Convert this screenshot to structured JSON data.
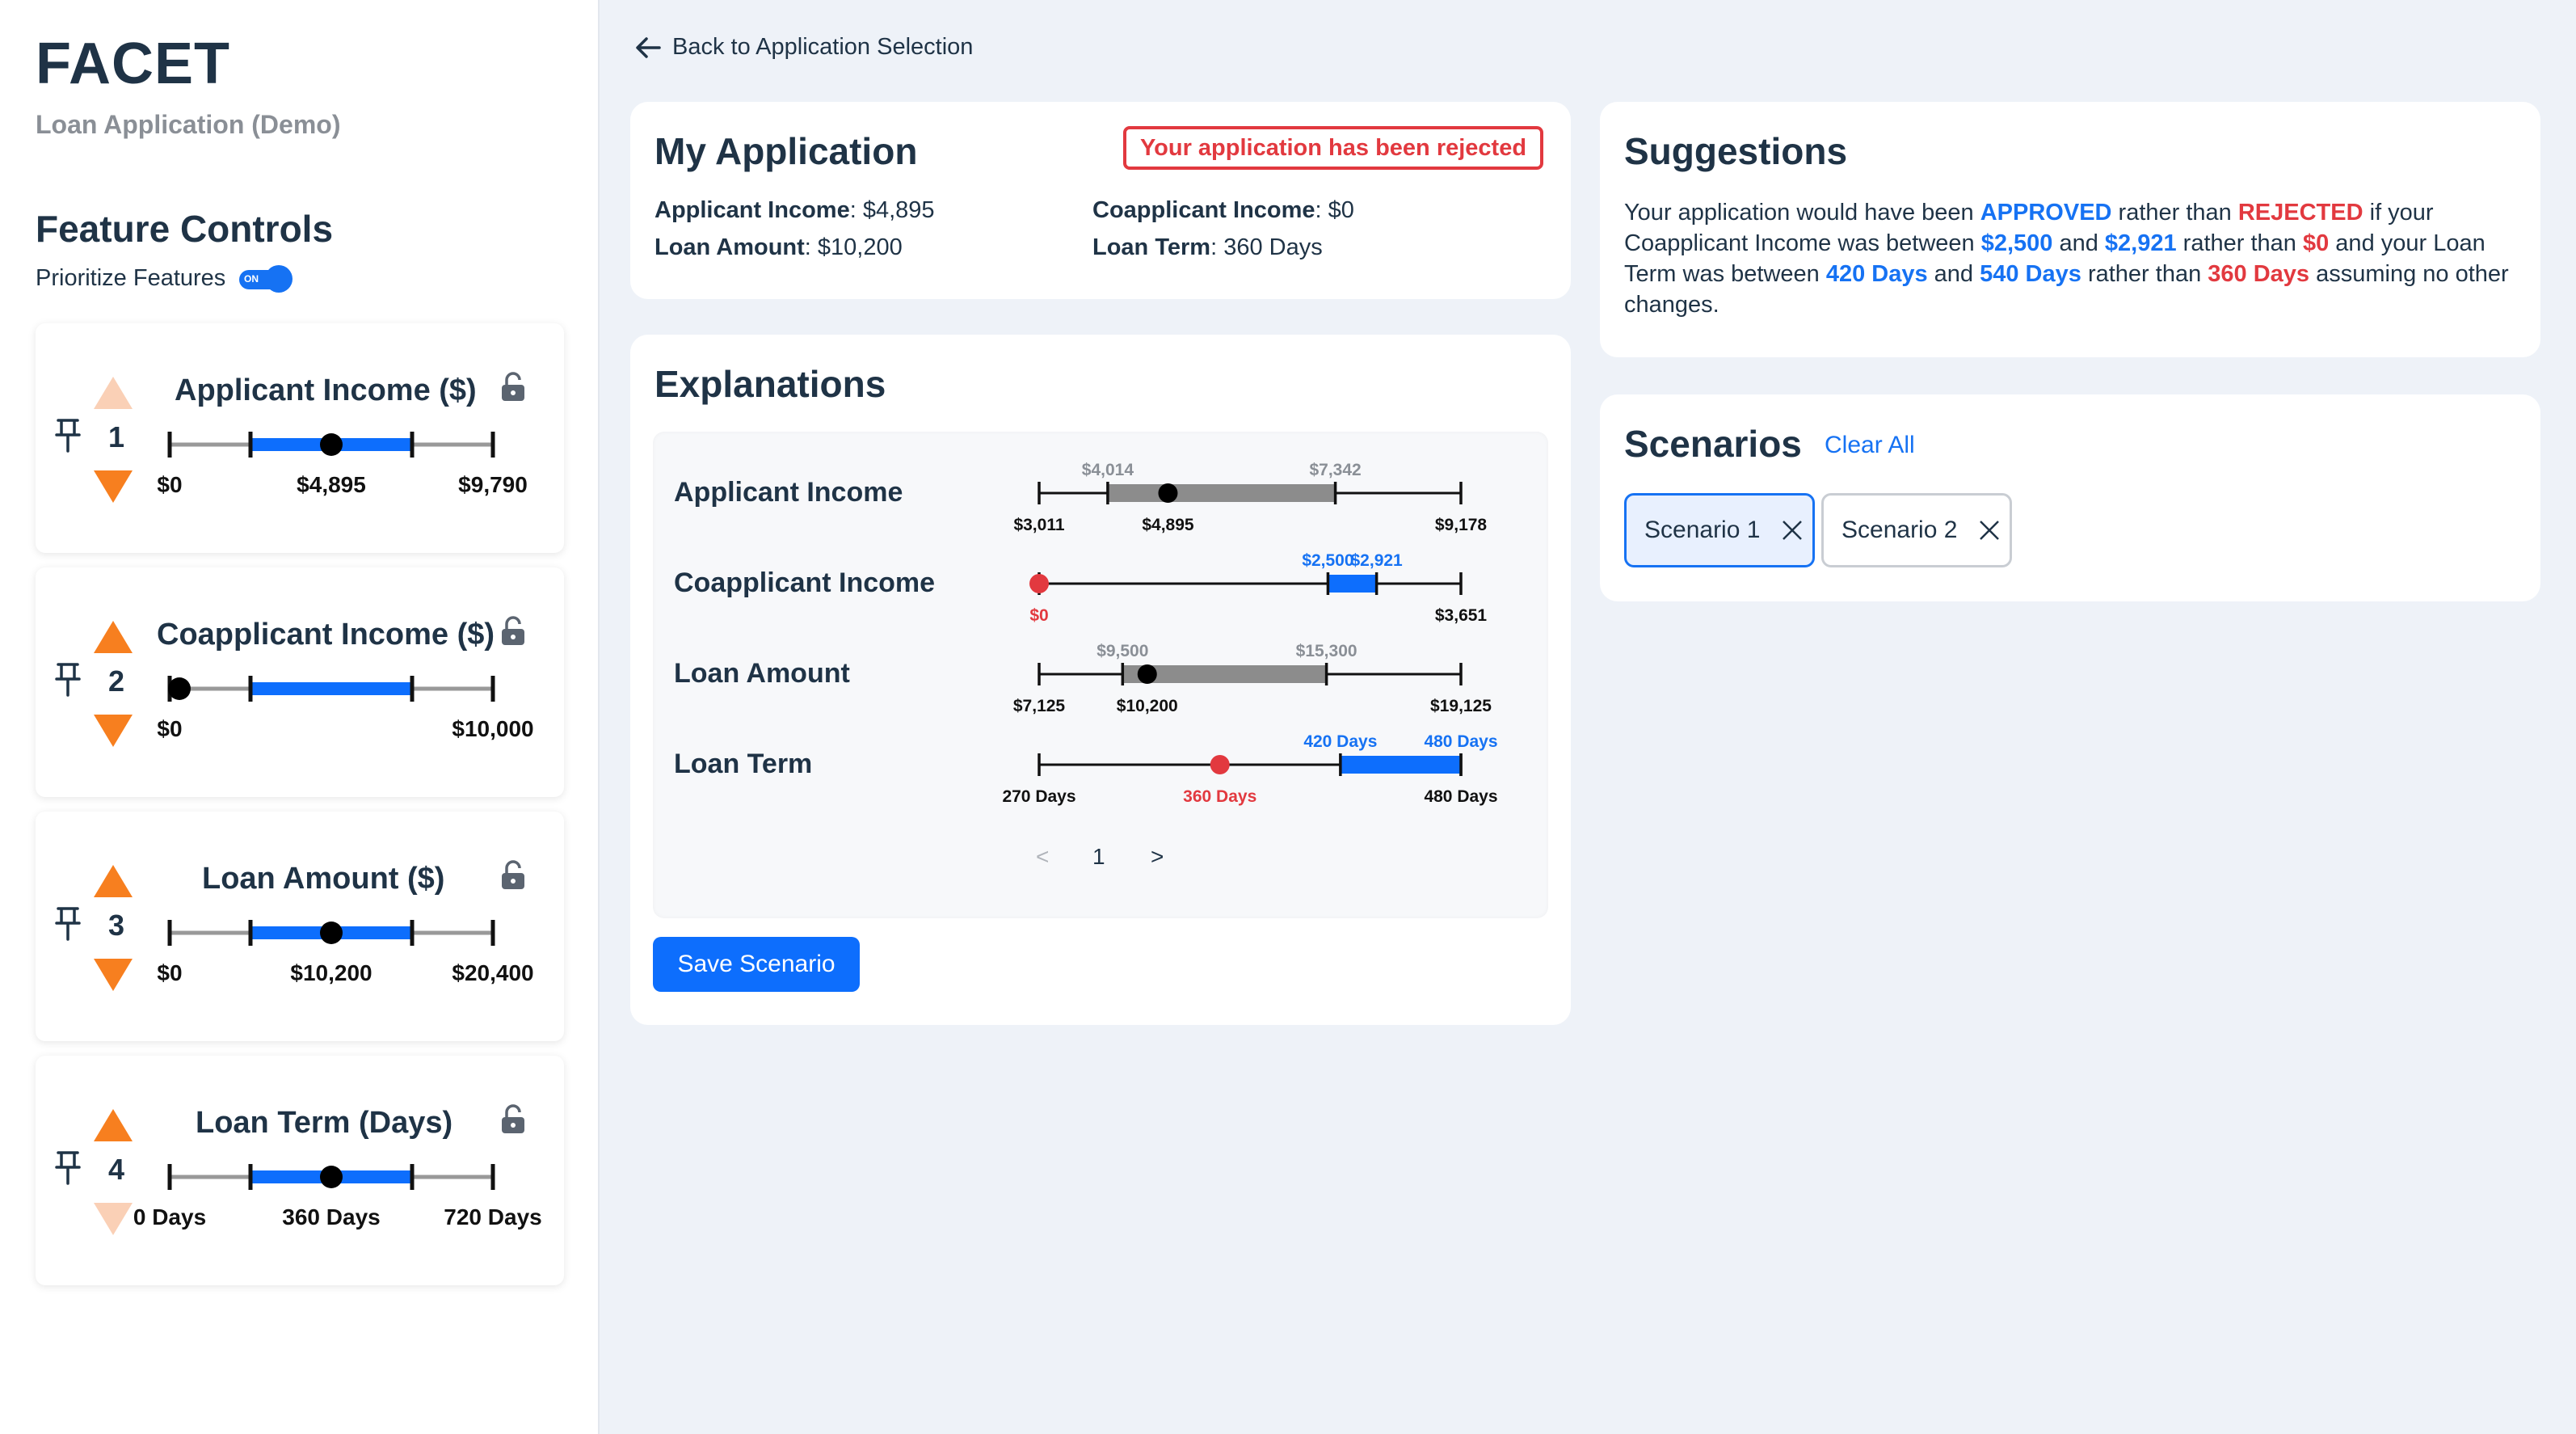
{
  "sidebar": {
    "brand": "FACET",
    "subtitle": "Loan Application (Demo)",
    "feature_controls_title": "Feature Controls",
    "prioritize_label": "Prioritize Features",
    "prioritize_toggle_text": "ON",
    "features": [
      {
        "title": "Applicant Income ($)",
        "rank": "1",
        "min_label": "$0",
        "value_label": "$4,895",
        "max_label": "$9,790",
        "value_fraction": 0.5,
        "range": [
          0.25,
          0.75
        ],
        "up_enabled": false,
        "down_enabled": true
      },
      {
        "title": "Coapplicant Income ($)",
        "rank": "2",
        "min_label": "$0",
        "value_label": "",
        "max_label": "$10,000",
        "value_fraction": 0.03,
        "range": [
          0.25,
          0.75
        ],
        "up_enabled": true,
        "down_enabled": true
      },
      {
        "title": "Loan Amount ($)",
        "rank": "3",
        "min_label": "$0",
        "value_label": "$10,200",
        "max_label": "$20,400",
        "value_fraction": 0.5,
        "range": [
          0.25,
          0.75
        ],
        "up_enabled": true,
        "down_enabled": true
      },
      {
        "title": "Loan Term (Days)",
        "rank": "4",
        "min_label": "0 Days",
        "value_label": "360 Days",
        "max_label": "720 Days",
        "value_fraction": 0.5,
        "range": [
          0.25,
          0.75
        ],
        "up_enabled": true,
        "down_enabled": false
      }
    ]
  },
  "nav": {
    "back_label": "Back to Application Selection"
  },
  "application": {
    "title": "My Application",
    "status": "Your application has been rejected",
    "fields": {
      "applicant_income_label": "Applicant Income",
      "applicant_income_value": ": $4,895",
      "coapplicant_income_label": "Coapplicant Income",
      "coapplicant_income_value": ": $0",
      "loan_amount_label": "Loan Amount",
      "loan_amount_value": ": $10,200",
      "loan_term_label": "Loan Term",
      "loan_term_value": ": 360 Days"
    }
  },
  "explanations": {
    "title": "Explanations",
    "rows": [
      {
        "label": "Applicant Income",
        "min": 3011,
        "max": 9178,
        "min_label": "$3,011",
        "max_label": "$9,178",
        "value": 4895,
        "value_label": "$4,895",
        "range": [
          4014,
          7342
        ],
        "range_labels": [
          "$4,014",
          "$7,342"
        ],
        "range_color": "#8c8c8c",
        "value_color": "#000000",
        "range_label_color": "#8a8f96",
        "value_label_color": "#111111"
      },
      {
        "label": "Coapplicant Income",
        "min": 0,
        "max": 3651,
        "min_label": "",
        "max_label": "$3,651",
        "value": 0,
        "value_label": "$0",
        "range": [
          2500,
          2921
        ],
        "range_labels": [
          "$2,500",
          "$2,921"
        ],
        "range_color": "#0d6efd",
        "value_color": "#e2393f",
        "range_label_color": "#1672f3",
        "value_label_color": "#e2393f"
      },
      {
        "label": "Loan Amount",
        "min": 7125,
        "max": 19125,
        "min_label": "$7,125",
        "max_label": "$19,125",
        "value": 10200,
        "value_label": "$10,200",
        "range": [
          9500,
          15300
        ],
        "range_labels": [
          "$9,500",
          "$15,300"
        ],
        "range_color": "#8c8c8c",
        "value_color": "#000000",
        "range_label_color": "#8a8f96",
        "value_label_color": "#111111"
      },
      {
        "label": "Loan Term",
        "min": 270,
        "max": 480,
        "min_label": "270 Days",
        "max_label": "480 Days",
        "value": 360,
        "value_label": "360 Days",
        "range": [
          420,
          480
        ],
        "range_labels": [
          "420 Days",
          "480 Days"
        ],
        "range_color": "#0d6efd",
        "value_color": "#e2393f",
        "range_label_color": "#1672f3",
        "value_label_color": "#e2393f"
      }
    ],
    "pager": {
      "prev": "<",
      "page": "1",
      "next": ">"
    },
    "save_label": "Save Scenario"
  },
  "suggestions": {
    "title": "Suggestions",
    "parts": {
      "p1": "Your application would have been ",
      "approved": "APPROVED",
      "p2": " rather than ",
      "rejected": "REJECTED",
      "p3": " if your Coapplicant Income was between ",
      "ci_low": "$2,500",
      "p4": " and ",
      "ci_high": "$2,921",
      "p5": " rather than ",
      "ci_current": "$0",
      "p6": " and your Loan Term was between ",
      "lt_low": "420 Days",
      "p7": " and ",
      "lt_high": "540 Days",
      "p8": " rather than ",
      "lt_current": "360 Days",
      "p9": " assuming no other changes."
    }
  },
  "scenarios": {
    "title": "Scenarios",
    "clear_label": "Clear All",
    "items": [
      {
        "label": "Scenario 1",
        "active": true
      },
      {
        "label": "Scenario 2",
        "active": false
      }
    ]
  },
  "colors": {
    "accent_blue": "#0d6efd",
    "reject_red": "#e2393f",
    "arrow_orange": "#f77f1f",
    "heading": "#1f3346"
  }
}
